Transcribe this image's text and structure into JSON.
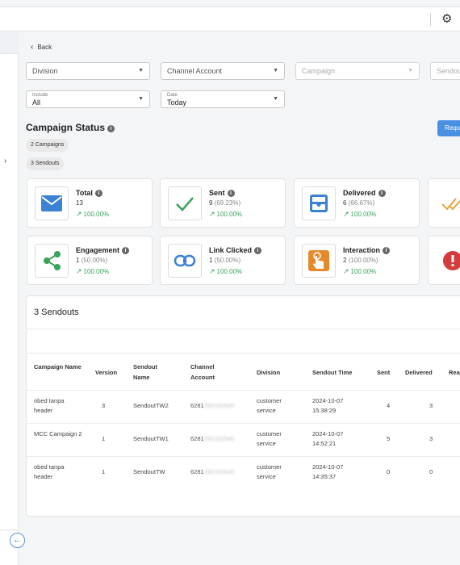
{
  "header": {
    "settings_icon": "gear-icon"
  },
  "nav": {
    "back": "Back"
  },
  "filters": {
    "division": "Division",
    "channel_account": "Channel Account",
    "campaign": "Campaign",
    "sendout": "Sendou",
    "include_label": "Include",
    "include_value": "All",
    "date_label": "Date",
    "date_value": "Today"
  },
  "status": {
    "title": "Campaign Status",
    "pill_campaigns": "2 Campaigns",
    "pill_sendouts": "3 Sendouts",
    "request_button": "Requ"
  },
  "cards": [
    {
      "title": "Total",
      "value": "13",
      "pct": "",
      "trend": "100.00%",
      "icon": "envelope-icon",
      "color": "#3b82d6"
    },
    {
      "title": "Sent",
      "value": "9",
      "pct": "(69.23%)",
      "trend": "100.00%",
      "icon": "checkmark-icon",
      "color": "#3aa35a"
    },
    {
      "title": "Delivered",
      "value": "6",
      "pct": "(66.67%)",
      "trend": "100.00%",
      "icon": "inbox-tray-icon",
      "color": "#3b82d6"
    },
    {
      "title": "Engagement",
      "value": "1",
      "pct": "(50.00%)",
      "trend": "100.00%",
      "icon": "share-icon",
      "color": "#3aa35a"
    },
    {
      "title": "Link Clicked",
      "value": "1",
      "pct": "(50.00%)",
      "trend": "100.00%",
      "icon": "link-icon",
      "color": "#3b82d6"
    },
    {
      "title": "Interaction",
      "value": "2",
      "pct": "(100.00%)",
      "trend": "100.00%",
      "icon": "tap-hand-icon",
      "color": "#e58a2b"
    }
  ],
  "sendouts": {
    "title": "3 Sendouts",
    "columns": [
      "Campaign Name",
      "Version",
      "Sendout Name",
      "Channel Account",
      "Division",
      "Sendout Time",
      "Sent",
      "Delivered",
      "Rea"
    ],
    "rows": [
      {
        "campaign": "obed tanpa header",
        "version": "3",
        "sendout": "SendoutTW2",
        "channel": "6281",
        "division": "customer service",
        "time": "2024-10-07 15:38:29",
        "sent": "4",
        "delivered": "3"
      },
      {
        "campaign": "MCC Campaign 2",
        "version": "1",
        "sendout": "SendoutTW1",
        "channel": "6281",
        "division": "customer service",
        "time": "2024-10-07 14:52:21",
        "sent": "5",
        "delivered": "3"
      },
      {
        "campaign": "obed tanpa header",
        "version": "1",
        "sendout": "SendoutTW",
        "channel": "6281",
        "division": "customer service",
        "time": "2024-10-07 14:35:37",
        "sent": "0",
        "delivered": "0"
      }
    ]
  }
}
